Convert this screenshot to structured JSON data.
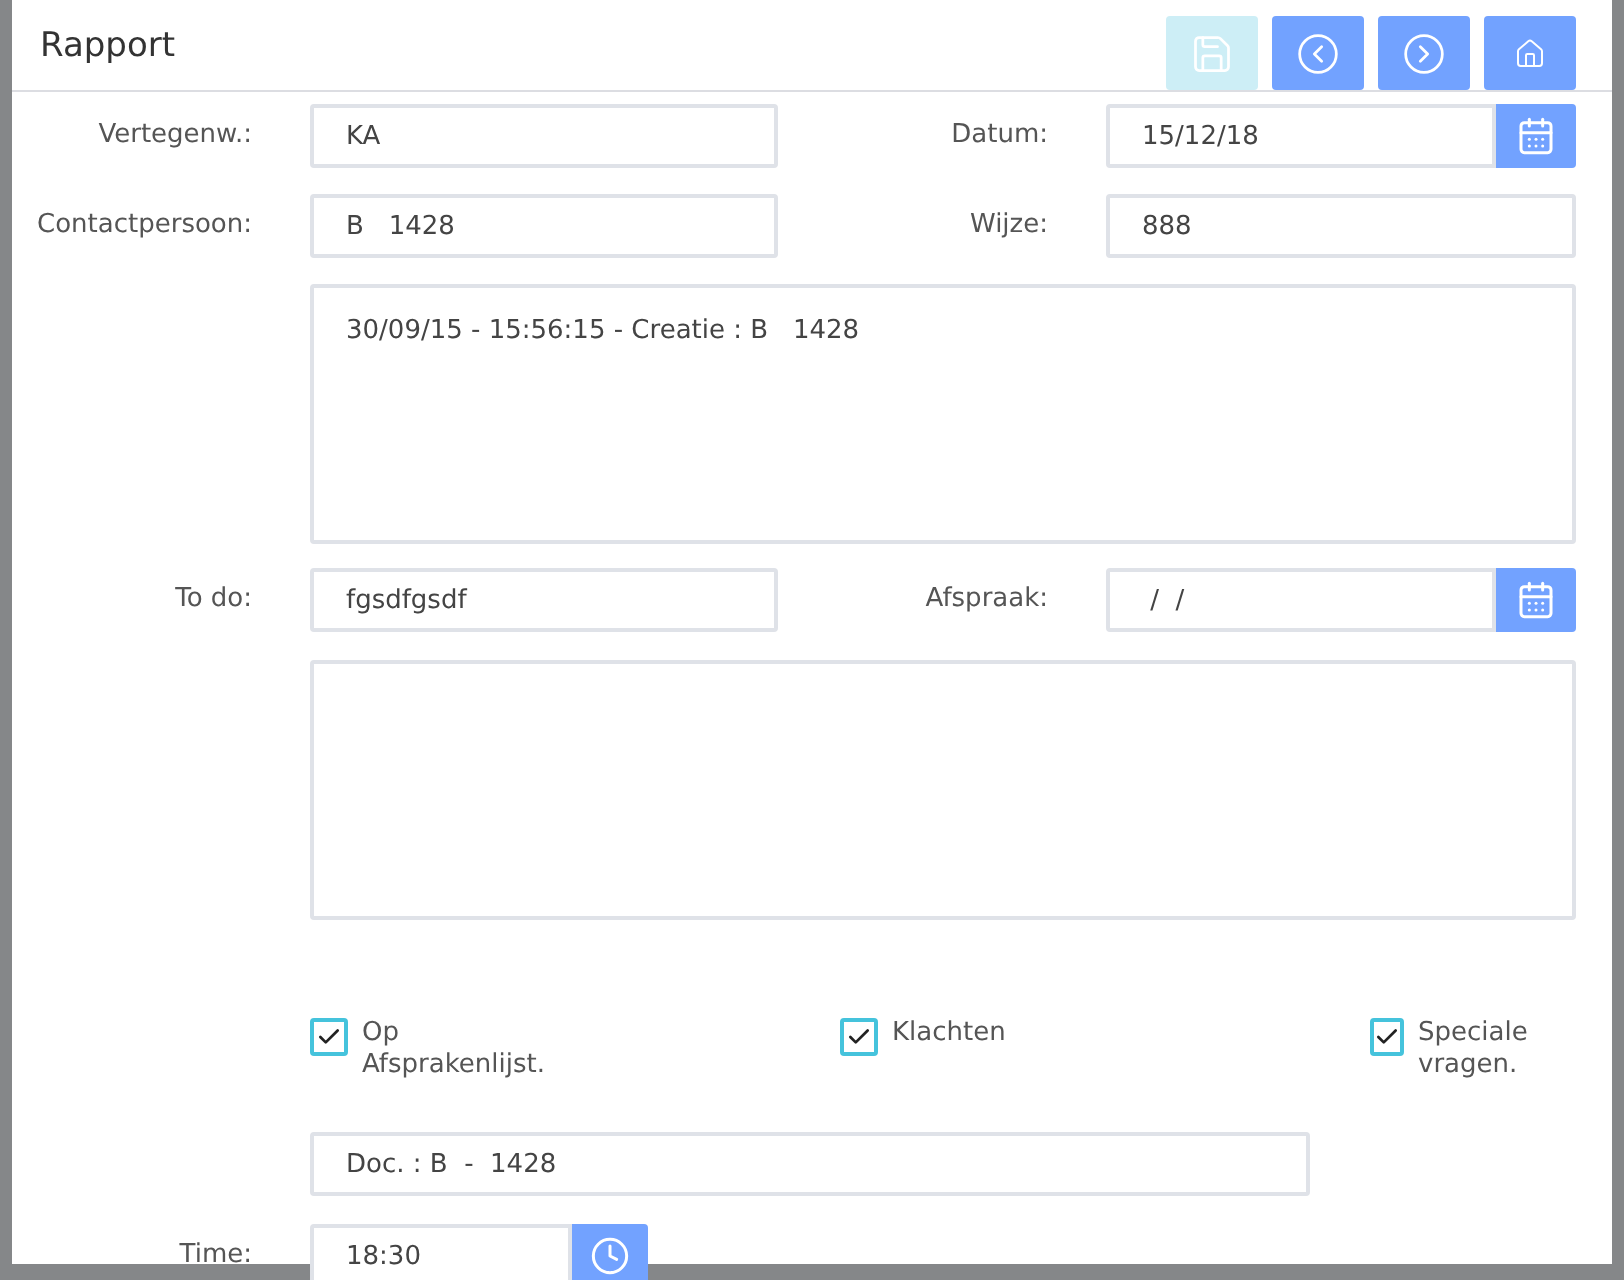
{
  "dialog": {
    "title": "Rapport",
    "toolbar": [
      {
        "kind": "save",
        "disabled": true
      },
      {
        "kind": "previous",
        "disabled": false
      },
      {
        "kind": "next",
        "disabled": false
      },
      {
        "kind": "home",
        "disabled": false
      }
    ]
  },
  "rows": [
    {
      "kind": "pair",
      "left": {
        "label": "Vertegenw.:",
        "value": "KA"
      },
      "right": {
        "label": "Datum:",
        "value": "15/12/18",
        "kind": "date"
      }
    },
    {
      "kind": "pair",
      "left": {
        "label": "Contactpersoon:",
        "value": "B   1428"
      },
      "right": {
        "label": "Wijze:",
        "value": "888"
      }
    },
    {
      "kind": "memo",
      "value": "30/09/15 - 15:56:15 - Creatie : B   1428"
    },
    {
      "kind": "pair",
      "left": {
        "label": "To do:",
        "value": "fgsdfgsdf"
      },
      "right": {
        "label": "Afspraak:",
        "value": " /  /",
        "kind": "date"
      }
    },
    {
      "kind": "memo"
    },
    {
      "kind": "checks",
      "items": [
        {
          "label": "Op Afsprakenlijst.",
          "checked": true
        },
        {
          "label": "Klachten",
          "checked": true
        },
        {
          "label": "Speciale vragen.",
          "checked": true
        }
      ]
    },
    {
      "kind": "wide",
      "value": "Doc. : B  -  1428"
    },
    {
      "kind": "single",
      "left": {
        "label": "Time:",
        "value": "18:30",
        "kind": "time"
      }
    }
  ]
}
